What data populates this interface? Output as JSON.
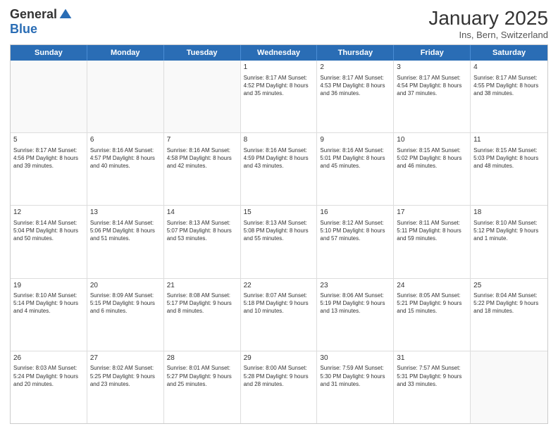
{
  "logo": {
    "general": "General",
    "blue": "Blue"
  },
  "title": {
    "month": "January 2025",
    "location": "Ins, Bern, Switzerland"
  },
  "weekdays": [
    "Sunday",
    "Monday",
    "Tuesday",
    "Wednesday",
    "Thursday",
    "Friday",
    "Saturday"
  ],
  "weeks": [
    [
      {
        "day": "",
        "info": ""
      },
      {
        "day": "",
        "info": ""
      },
      {
        "day": "",
        "info": ""
      },
      {
        "day": "1",
        "info": "Sunrise: 8:17 AM\nSunset: 4:52 PM\nDaylight: 8 hours\nand 35 minutes."
      },
      {
        "day": "2",
        "info": "Sunrise: 8:17 AM\nSunset: 4:53 PM\nDaylight: 8 hours\nand 36 minutes."
      },
      {
        "day": "3",
        "info": "Sunrise: 8:17 AM\nSunset: 4:54 PM\nDaylight: 8 hours\nand 37 minutes."
      },
      {
        "day": "4",
        "info": "Sunrise: 8:17 AM\nSunset: 4:55 PM\nDaylight: 8 hours\nand 38 minutes."
      }
    ],
    [
      {
        "day": "5",
        "info": "Sunrise: 8:17 AM\nSunset: 4:56 PM\nDaylight: 8 hours\nand 39 minutes."
      },
      {
        "day": "6",
        "info": "Sunrise: 8:16 AM\nSunset: 4:57 PM\nDaylight: 8 hours\nand 40 minutes."
      },
      {
        "day": "7",
        "info": "Sunrise: 8:16 AM\nSunset: 4:58 PM\nDaylight: 8 hours\nand 42 minutes."
      },
      {
        "day": "8",
        "info": "Sunrise: 8:16 AM\nSunset: 4:59 PM\nDaylight: 8 hours\nand 43 minutes."
      },
      {
        "day": "9",
        "info": "Sunrise: 8:16 AM\nSunset: 5:01 PM\nDaylight: 8 hours\nand 45 minutes."
      },
      {
        "day": "10",
        "info": "Sunrise: 8:15 AM\nSunset: 5:02 PM\nDaylight: 8 hours\nand 46 minutes."
      },
      {
        "day": "11",
        "info": "Sunrise: 8:15 AM\nSunset: 5:03 PM\nDaylight: 8 hours\nand 48 minutes."
      }
    ],
    [
      {
        "day": "12",
        "info": "Sunrise: 8:14 AM\nSunset: 5:04 PM\nDaylight: 8 hours\nand 50 minutes."
      },
      {
        "day": "13",
        "info": "Sunrise: 8:14 AM\nSunset: 5:06 PM\nDaylight: 8 hours\nand 51 minutes."
      },
      {
        "day": "14",
        "info": "Sunrise: 8:13 AM\nSunset: 5:07 PM\nDaylight: 8 hours\nand 53 minutes."
      },
      {
        "day": "15",
        "info": "Sunrise: 8:13 AM\nSunset: 5:08 PM\nDaylight: 8 hours\nand 55 minutes."
      },
      {
        "day": "16",
        "info": "Sunrise: 8:12 AM\nSunset: 5:10 PM\nDaylight: 8 hours\nand 57 minutes."
      },
      {
        "day": "17",
        "info": "Sunrise: 8:11 AM\nSunset: 5:11 PM\nDaylight: 8 hours\nand 59 minutes."
      },
      {
        "day": "18",
        "info": "Sunrise: 8:10 AM\nSunset: 5:12 PM\nDaylight: 9 hours\nand 1 minute."
      }
    ],
    [
      {
        "day": "19",
        "info": "Sunrise: 8:10 AM\nSunset: 5:14 PM\nDaylight: 9 hours\nand 4 minutes."
      },
      {
        "day": "20",
        "info": "Sunrise: 8:09 AM\nSunset: 5:15 PM\nDaylight: 9 hours\nand 6 minutes."
      },
      {
        "day": "21",
        "info": "Sunrise: 8:08 AM\nSunset: 5:17 PM\nDaylight: 9 hours\nand 8 minutes."
      },
      {
        "day": "22",
        "info": "Sunrise: 8:07 AM\nSunset: 5:18 PM\nDaylight: 9 hours\nand 10 minutes."
      },
      {
        "day": "23",
        "info": "Sunrise: 8:06 AM\nSunset: 5:19 PM\nDaylight: 9 hours\nand 13 minutes."
      },
      {
        "day": "24",
        "info": "Sunrise: 8:05 AM\nSunset: 5:21 PM\nDaylight: 9 hours\nand 15 minutes."
      },
      {
        "day": "25",
        "info": "Sunrise: 8:04 AM\nSunset: 5:22 PM\nDaylight: 9 hours\nand 18 minutes."
      }
    ],
    [
      {
        "day": "26",
        "info": "Sunrise: 8:03 AM\nSunset: 5:24 PM\nDaylight: 9 hours\nand 20 minutes."
      },
      {
        "day": "27",
        "info": "Sunrise: 8:02 AM\nSunset: 5:25 PM\nDaylight: 9 hours\nand 23 minutes."
      },
      {
        "day": "28",
        "info": "Sunrise: 8:01 AM\nSunset: 5:27 PM\nDaylight: 9 hours\nand 25 minutes."
      },
      {
        "day": "29",
        "info": "Sunrise: 8:00 AM\nSunset: 5:28 PM\nDaylight: 9 hours\nand 28 minutes."
      },
      {
        "day": "30",
        "info": "Sunrise: 7:59 AM\nSunset: 5:30 PM\nDaylight: 9 hours\nand 31 minutes."
      },
      {
        "day": "31",
        "info": "Sunrise: 7:57 AM\nSunset: 5:31 PM\nDaylight: 9 hours\nand 33 minutes."
      },
      {
        "day": "",
        "info": ""
      }
    ]
  ]
}
